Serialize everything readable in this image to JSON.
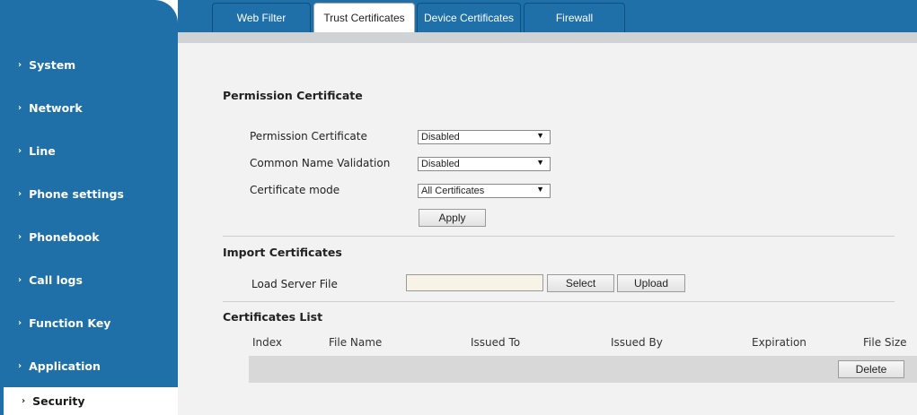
{
  "sidebar": {
    "items": [
      {
        "label": "System",
        "active": false
      },
      {
        "label": "Network",
        "active": false
      },
      {
        "label": "Line",
        "active": false
      },
      {
        "label": "Phone settings",
        "active": false
      },
      {
        "label": "Phonebook",
        "active": false
      },
      {
        "label": "Call logs",
        "active": false
      },
      {
        "label": "Function Key",
        "active": false
      },
      {
        "label": "Application",
        "active": false
      },
      {
        "label": "Security",
        "active": true
      }
    ]
  },
  "tabs": [
    {
      "label": "Web Filter",
      "active": false
    },
    {
      "label": "Trust Certificates",
      "active": true
    },
    {
      "label": "Device Certificates",
      "active": false
    },
    {
      "label": "Firewall",
      "active": false
    }
  ],
  "permission": {
    "title": "Permission Certificate",
    "fields": [
      {
        "label": "Permission Certificate",
        "value": "Disabled"
      },
      {
        "label": "Common Name Validation",
        "value": "Disabled"
      },
      {
        "label": "Certificate mode",
        "value": "All Certificates"
      }
    ],
    "apply_label": "Apply"
  },
  "import": {
    "title": "Import Certificates",
    "load_label": "Load Server File",
    "load_value": "",
    "select_label": "Select",
    "upload_label": "Upload"
  },
  "cert_list": {
    "title": "Certificates List",
    "columns": [
      "Index",
      "File Name",
      "Issued To",
      "Issued By",
      "Expiration",
      "File Size"
    ],
    "delete_label": "Delete"
  },
  "colors": {
    "accent": "#1f6fa8",
    "content_bg": "#f2f2f2",
    "row_bg": "#d8d8d8"
  }
}
